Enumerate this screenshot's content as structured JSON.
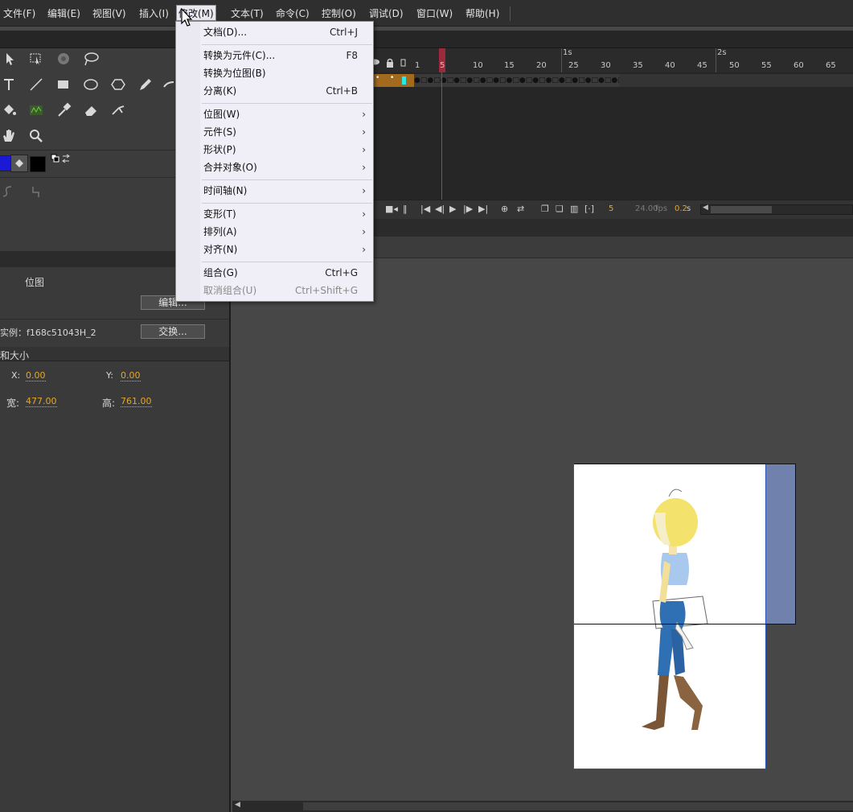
{
  "menubar": {
    "items": [
      "文件(F)",
      "编辑(E)",
      "视图(V)",
      "插入(I)",
      "修改(M)",
      "文本(T)",
      "命令(C)",
      "控制(O)",
      "调试(D)",
      "窗口(W)",
      "帮助(H)"
    ],
    "active": "修改(M)"
  },
  "modify_menu": {
    "document": {
      "label": "文档(D)...",
      "shortcut": "Ctrl+J"
    },
    "convert_symbol": {
      "label": "转换为元件(C)...",
      "shortcut": "F8"
    },
    "convert_bitmap": {
      "label": "转换为位图(B)"
    },
    "break_apart": {
      "label": "分离(K)",
      "shortcut": "Ctrl+B"
    },
    "bitmap": {
      "label": "位图(W)"
    },
    "symbol": {
      "label": "元件(S)"
    },
    "shape": {
      "label": "形状(P)"
    },
    "combine": {
      "label": "合并对象(O)"
    },
    "timeline": {
      "label": "时间轴(N)"
    },
    "transform": {
      "label": "变形(T)"
    },
    "arrange": {
      "label": "排列(A)"
    },
    "align": {
      "label": "对齐(N)"
    },
    "group": {
      "label": "组合(G)",
      "shortcut": "Ctrl+G"
    },
    "ungroup": {
      "label": "取消组合(U)",
      "shortcut": "Ctrl+Shift+G"
    },
    "arrow": "›"
  },
  "properties": {
    "type_label": "位图",
    "edit_button": "编辑...",
    "instance_label": "实例：f168c51043H_2",
    "swap_button": "交换...",
    "section_title": "和大小",
    "x_label": "X:",
    "x_value": "0.00",
    "y_label": "Y:",
    "y_value": "0.00",
    "w_label": "宽:",
    "w_value": "477.00",
    "h_label": "高:",
    "h_value": "761.00"
  },
  "timeline": {
    "seconds": [
      "1s",
      "2s"
    ],
    "ticks": [
      "1",
      "5",
      "10",
      "15",
      "20",
      "25",
      "30",
      "35",
      "40",
      "45",
      "50",
      "55",
      "60",
      "65"
    ],
    "frames_pattern": "●□●□●□●□●□●□●□●□●□●□●□●□●□●□●□●□●□●□●□●□●□●□●□●□●□●□●□●□●□●□●□●□●□",
    "current_frame": "5",
    "fps": "24.00",
    "fps_unit": "fps",
    "time": "0.2",
    "time_unit": "s"
  },
  "colors": {
    "accent_orange": "#e6a628",
    "menu_bg": "#f0eef6",
    "stroke_swatch": "#1a1ad6",
    "playhead": "#c23344"
  }
}
